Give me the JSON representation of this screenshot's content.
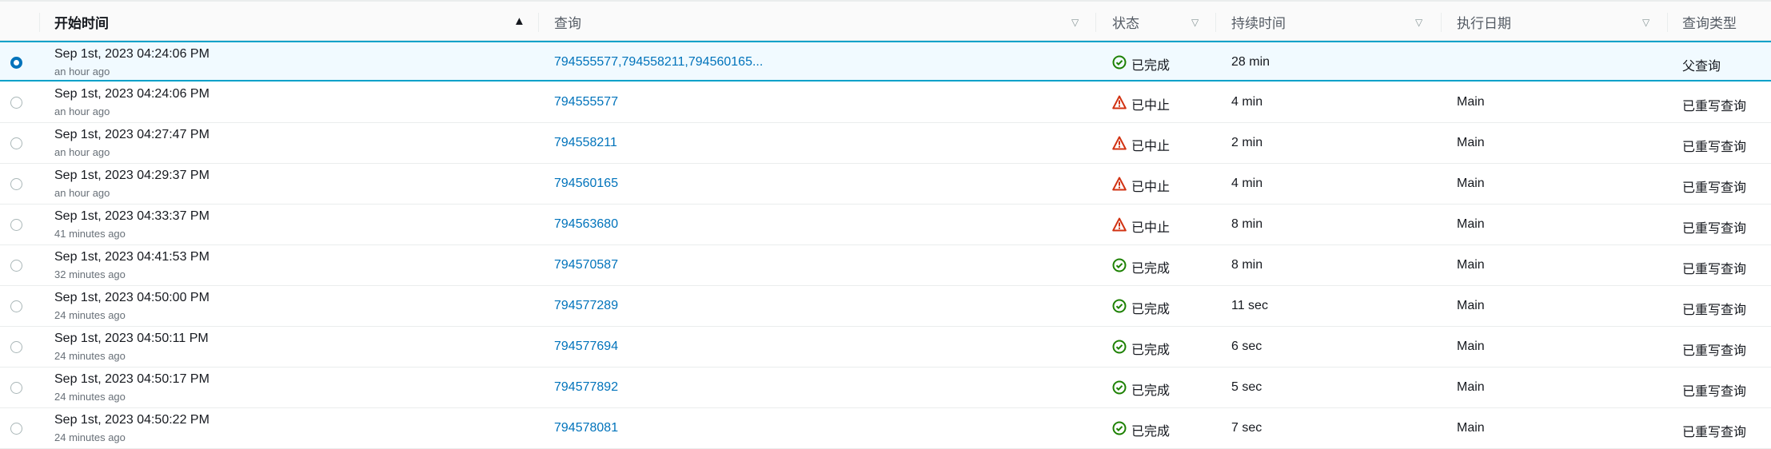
{
  "headers": {
    "start_time": "开始时间",
    "query": "查询",
    "status": "状态",
    "duration": "持续时间",
    "exec_date": "执行日期",
    "query_type": "查询类型"
  },
  "colors": {
    "link": "#0073bb",
    "success": "#1d8102",
    "error": "#d13212",
    "selected_border": "#00a1c9"
  },
  "rows": [
    {
      "selected": true,
      "date": "Sep 1st, 2023 04:24:06 PM",
      "ago": "an hour ago",
      "query": "794555577,794558211,794560165...",
      "status": "已完成",
      "status_icon": "check-circle-icon",
      "duration": "28 min",
      "exec_date": "",
      "type": "父查询"
    },
    {
      "selected": false,
      "date": "Sep 1st, 2023 04:24:06 PM",
      "ago": "an hour ago",
      "query": "794555577",
      "status": "已中止",
      "status_icon": "warning-icon",
      "duration": "4 min",
      "exec_date": "Main",
      "type": "已重写查询"
    },
    {
      "selected": false,
      "date": "Sep 1st, 2023 04:27:47 PM",
      "ago": "an hour ago",
      "query": "794558211",
      "status": "已中止",
      "status_icon": "warning-icon",
      "duration": "2 min",
      "exec_date": "Main",
      "type": "已重写查询"
    },
    {
      "selected": false,
      "date": "Sep 1st, 2023 04:29:37 PM",
      "ago": "an hour ago",
      "query": "794560165",
      "status": "已中止",
      "status_icon": "warning-icon",
      "duration": "4 min",
      "exec_date": "Main",
      "type": "已重写查询"
    },
    {
      "selected": false,
      "date": "Sep 1st, 2023 04:33:37 PM",
      "ago": "41 minutes ago",
      "query": "794563680",
      "status": "已中止",
      "status_icon": "warning-icon",
      "duration": "8 min",
      "exec_date": "Main",
      "type": "已重写查询"
    },
    {
      "selected": false,
      "date": "Sep 1st, 2023 04:41:53 PM",
      "ago": "32 minutes ago",
      "query": "794570587",
      "status": "已完成",
      "status_icon": "check-circle-icon",
      "duration": "8 min",
      "exec_date": "Main",
      "type": "已重写查询"
    },
    {
      "selected": false,
      "date": "Sep 1st, 2023 04:50:00 PM",
      "ago": "24 minutes ago",
      "query": "794577289",
      "status": "已完成",
      "status_icon": "check-circle-icon",
      "duration": "11 sec",
      "exec_date": "Main",
      "type": "已重写查询"
    },
    {
      "selected": false,
      "date": "Sep 1st, 2023 04:50:11 PM",
      "ago": "24 minutes ago",
      "query": "794577694",
      "status": "已完成",
      "status_icon": "check-circle-icon",
      "duration": "6 sec",
      "exec_date": "Main",
      "type": "已重写查询"
    },
    {
      "selected": false,
      "date": "Sep 1st, 2023 04:50:17 PM",
      "ago": "24 minutes ago",
      "query": "794577892",
      "status": "已完成",
      "status_icon": "check-circle-icon",
      "duration": "5 sec",
      "exec_date": "Main",
      "type": "已重写查询"
    },
    {
      "selected": false,
      "date": "Sep 1st, 2023 04:50:22 PM",
      "ago": "24 minutes ago",
      "query": "794578081",
      "status": "已完成",
      "status_icon": "check-circle-icon",
      "duration": "7 sec",
      "exec_date": "Main",
      "type": "已重写查询"
    }
  ]
}
